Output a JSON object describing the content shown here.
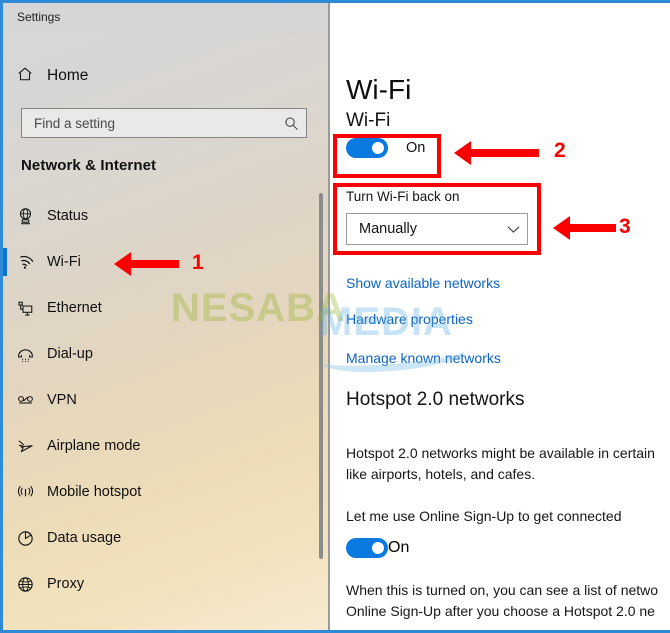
{
  "window": {
    "title": "Settings",
    "border_color": "#2f8ad8"
  },
  "sidebar": {
    "home_label": "Home",
    "home_icon": "home-icon",
    "search": {
      "placeholder": "Find a setting",
      "value": "",
      "icon": "search-icon"
    },
    "category_title": "Network & Internet",
    "items": [
      {
        "label": "Status",
        "icon": "status-globe-monitor-icon",
        "selected": false
      },
      {
        "label": "Wi-Fi",
        "icon": "wifi-icon",
        "selected": true
      },
      {
        "label": "Ethernet",
        "icon": "ethernet-icon",
        "selected": false
      },
      {
        "label": "Dial-up",
        "icon": "dialup-phone-icon",
        "selected": false
      },
      {
        "label": "VPN",
        "icon": "vpn-key-icon",
        "selected": false
      },
      {
        "label": "Airplane mode",
        "icon": "airplane-icon",
        "selected": false
      },
      {
        "label": "Mobile hotspot",
        "icon": "hotspot-broadcast-icon",
        "selected": false
      },
      {
        "label": "Data usage",
        "icon": "data-usage-pie-icon",
        "selected": false
      },
      {
        "label": "Proxy",
        "icon": "proxy-globe-icon",
        "selected": false
      }
    ],
    "selected_accent_color": "#0a74da"
  },
  "main": {
    "page_title": "Wi-Fi",
    "wifi_section": {
      "heading": "Wi-Fi",
      "toggle_state": "On",
      "toggle_on": true,
      "toggle_color": "#0a7ae0",
      "turn_back_on_label": "Turn Wi-Fi back on",
      "turn_back_on_value": "Manually",
      "chevron_icon": "chevron-down-icon"
    },
    "links": [
      "Show available networks",
      "Hardware properties",
      "Manage known networks"
    ],
    "link_color": "#0b63c5",
    "hotspot_section": {
      "heading": "Hotspot 2.0 networks",
      "description": "Hotspot 2.0 networks might be available in certain\nlike airports, hotels, and cafes.",
      "signup_label": "Let me use Online Sign-Up to get connected",
      "signup_toggle_state": "On",
      "signup_toggle_on": true,
      "footnote": "When this is turned on, you can see a list of netwo\nOnline Sign-Up after you choose a Hotspot 2.0 ne"
    }
  },
  "watermark": {
    "part1": "NESABA",
    "part2": "MEDIA"
  },
  "annotations": {
    "color": "#fa0000",
    "markers": [
      {
        "number": "1",
        "target": "sidebar-item-wifi"
      },
      {
        "number": "2",
        "target": "wifi-toggle-box"
      },
      {
        "number": "3",
        "target": "turn-wifi-back-on-box"
      }
    ]
  }
}
